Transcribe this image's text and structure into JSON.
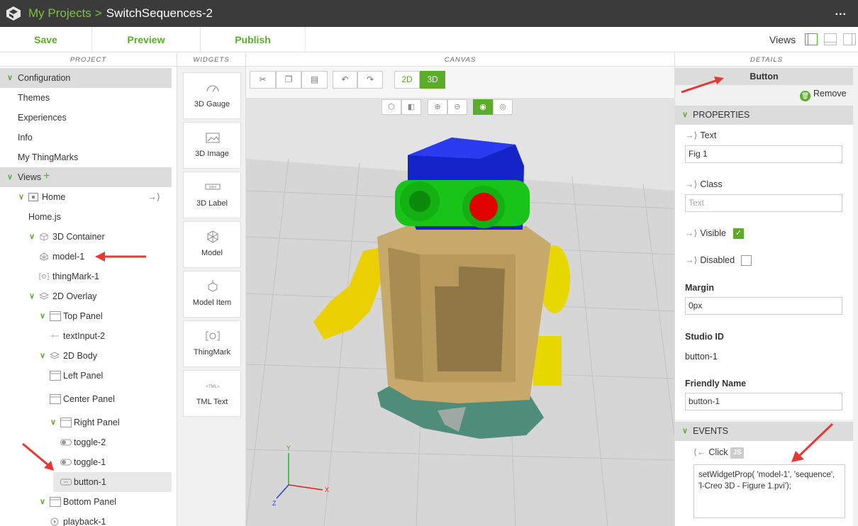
{
  "topbar": {
    "breadcrumb_link": "My Projects",
    "separator": ">",
    "project_name": "SwitchSequences-2",
    "more_label": "..."
  },
  "toolbar": {
    "save": "Save",
    "preview": "Preview",
    "publish": "Publish",
    "views_label": "Views"
  },
  "headers": {
    "project": "PROJECT",
    "widgets": "WIDGETS",
    "canvas": "CANVAS",
    "details": "DETAILS"
  },
  "project": {
    "configuration": "Configuration",
    "themes": "Themes",
    "experiences": "Experiences",
    "info": "Info",
    "my_thingmarks": "My ThingMarks",
    "views": "Views",
    "home": "Home",
    "home_js": "Home.js",
    "container_3d": "3D Container",
    "model_1": "model-1",
    "thingmark_1": "thingMark-1",
    "overlay_2d": "2D Overlay",
    "top_panel": "Top Panel",
    "text_input_2": "textInput-2",
    "body_2d": "2D Body",
    "left_panel": "Left Panel",
    "center_panel": "Center Panel",
    "right_panel": "Right Panel",
    "toggle_2": "toggle-2",
    "toggle_1": "toggle-1",
    "button_1": "button-1",
    "bottom_panel": "Bottom Panel",
    "playback_1": "playback-1"
  },
  "widgets": {
    "gauge": "3D Gauge",
    "image": "3D Image",
    "label": "3D Label",
    "model": "Model",
    "model_item": "Model Item",
    "thingmark": "ThingMark",
    "tml_text": "TML Text",
    "tml_icon_text": "<TML>",
    "label_icon_text": "label"
  },
  "canvas": {
    "mode_2d": "2D",
    "mode_3d": "3D",
    "axis_x": "X",
    "axis_y": "Y",
    "axis_z": "Z"
  },
  "details": {
    "title": "Button",
    "remove": "Remove",
    "properties": "PROPERTIES",
    "text_label": "Text",
    "text_value": "Fig 1",
    "class_label": "Class",
    "class_placeholder": "Text",
    "visible_label": "Visible",
    "visible_checked": true,
    "disabled_label": "Disabled",
    "disabled_checked": false,
    "margin_label": "Margin",
    "margin_value": "0px",
    "studio_id_label": "Studio ID",
    "studio_id_value": "button-1",
    "friendly_name_label": "Friendly Name",
    "friendly_name_value": "button-1",
    "events": "EVENTS",
    "click_label": "Click",
    "js_badge": "JS",
    "click_code": "setWidgetProp( 'model-1', 'sequence', 'l-Creo 3D - Figure 1.pvi');"
  },
  "colors": {
    "accent_green": "#5aac2a",
    "topbar_bg": "#3b3b3b",
    "arrow_red": "#e53935"
  }
}
